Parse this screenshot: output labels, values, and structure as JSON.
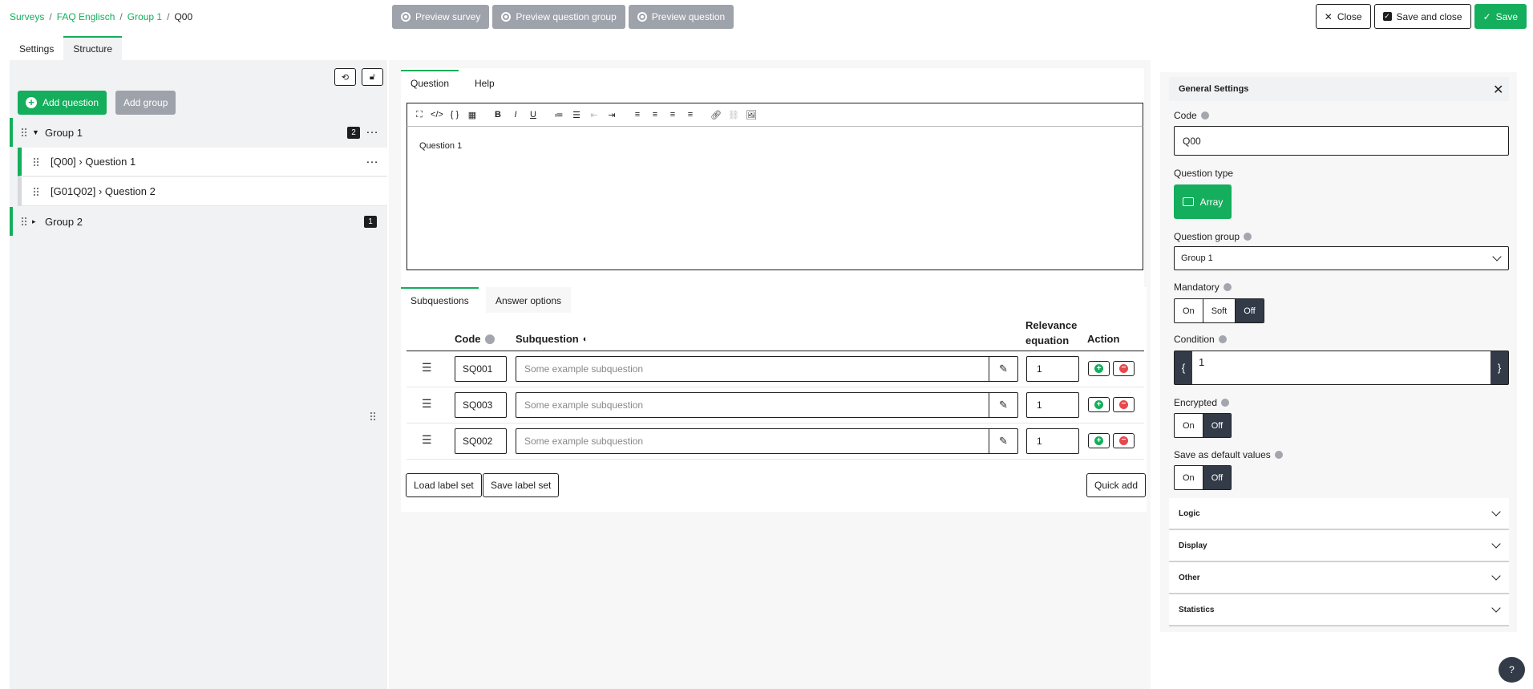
{
  "breadcrumb": {
    "surveys": "Surveys",
    "survey": "FAQ Englisch",
    "group": "Group 1",
    "current": "Q00",
    "sep": "/"
  },
  "preview": {
    "survey": "Preview survey",
    "group": "Preview question group",
    "question": "Preview question"
  },
  "actions": {
    "close": "Close",
    "save_close": "Save and close",
    "save": "Save"
  },
  "tabs": {
    "settings": "Settings",
    "structure": "Structure"
  },
  "tree": {
    "add_question": "Add question",
    "add_group": "Add group",
    "groups": [
      {
        "name": "Group 1",
        "count": "2"
      },
      {
        "name": "Group 2",
        "count": "1"
      }
    ],
    "questions": [
      {
        "label": "[Q00] › Question 1"
      },
      {
        "label": "[G01Q02] › Question 2"
      }
    ]
  },
  "editor": {
    "tab_question": "Question",
    "tab_help": "Help",
    "content": "Question 1"
  },
  "subquestions": {
    "tab_sub": "Subquestions",
    "tab_answer": "Answer options",
    "col_code": "Code",
    "col_sub": "Subquestion",
    "col_rel_1": "Relevance",
    "col_rel_2": "equation",
    "col_action": "Action",
    "rows": [
      {
        "code": "SQ001",
        "placeholder": "Some example subquestion",
        "relevance": "1"
      },
      {
        "code": "SQ003",
        "placeholder": "Some example subquestion",
        "relevance": "1"
      },
      {
        "code": "SQ002",
        "placeholder": "Some example subquestion",
        "relevance": "1"
      }
    ],
    "load_label": "Load label set",
    "save_label": "Save label set",
    "quick_add": "Quick add"
  },
  "settings": {
    "title": "General Settings",
    "code_label": "Code",
    "code_value": "Q00",
    "qtype_label": "Question type",
    "qtype_value": "Array",
    "qgroup_label": "Question group",
    "qgroup_value": "Group 1",
    "mandatory_label": "Mandatory",
    "mandatory": {
      "on": "On",
      "soft": "Soft",
      "off": "Off",
      "selected": "Off"
    },
    "condition_label": "Condition",
    "condition_value": "1",
    "encrypted_label": "Encrypted",
    "encrypted": {
      "on": "On",
      "off": "Off",
      "selected": "Off"
    },
    "default_label": "Save as default values",
    "default": {
      "on": "On",
      "off": "Off",
      "selected": "Off"
    },
    "sections": [
      "Logic",
      "Display",
      "Other",
      "Statistics"
    ]
  },
  "colors": {
    "accent": "#14ae5c",
    "dark": "#333b48",
    "muted": "#9ea2ab",
    "danger": "#e5484d"
  }
}
